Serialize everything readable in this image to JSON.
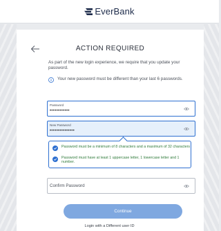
{
  "brand": {
    "name": "EverBank",
    "logo_icon": "everbank-logo-icon",
    "logo_color": "#1d2b4a"
  },
  "page": {
    "title": "ACTION REQUIRED",
    "back_icon": "back-arrow-icon",
    "intro": "As part of the new login experience, we require that you update your password.",
    "info_icon": "info-icon",
    "info_text": "Your new password must be different than your last 6 passwords."
  },
  "form": {
    "password": {
      "label": "Password",
      "value": "••••••••••••",
      "icon": "eye-icon"
    },
    "new_password": {
      "label": "New Password",
      "value": "•••••••••••••••",
      "icon": "eye-icon"
    },
    "rules": [
      {
        "icon": "check-circle-icon",
        "text": "Password must be a minimum of 8 characters and a maximum of 32 characters"
      },
      {
        "icon": "check-circle-icon",
        "text": "Password must have at least 1 uppercase letter, 1 lowercase letter and 1 number."
      }
    ],
    "confirm_password": {
      "placeholder": "Confirm Password",
      "icon": "eye-icon"
    },
    "continue_label": "Continue",
    "alt_link": "Login with a Different user ID"
  },
  "colors": {
    "accent": "#2d6fd0",
    "button": "#7fa8e0",
    "success": "#2f7a3a",
    "active_field": "#e6f0fb"
  }
}
